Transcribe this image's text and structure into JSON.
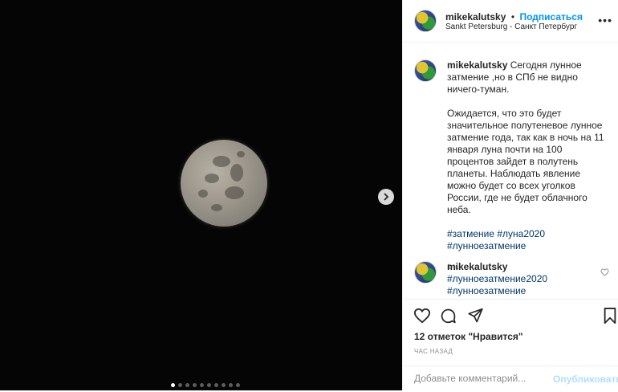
{
  "post": {
    "author": "mikekalutsky",
    "separator": "•",
    "follow_label": "Подписаться",
    "location": "Sankt Petersburg - Санкт Петербург",
    "more_icon": "more-horizontal-icon"
  },
  "caption": {
    "username": "mikekalutsky",
    "paragraph1": "Сегодня лунное затмение ,но в СПб не видно ничего-туман.",
    "paragraph2": "Ожидается, что это будет значительное полутеневое лунное затмение года, так как в ночь на 11 января луна почти на 100 процентов зайдет в полутень планеты. Наблюдать явление можно будет со всех уголков России, где не будет облачного неба.",
    "hashtags": [
      "#затмение",
      "#луна2020",
      "#лунноезатмение"
    ],
    "time": "1 ч."
  },
  "comment": {
    "username": "mikekalutsky",
    "hashtags": [
      "#лунноезатмение2020",
      "#лунноезатмение"
    ]
  },
  "actions": {
    "likes": "12 отметок \"Нравится\"",
    "time_ago": "ЧАС НАЗАД",
    "comment_placeholder": "Добавьте комментарий...",
    "publish_label": "Опубликовать"
  },
  "carousel": {
    "slide_count": 10,
    "active_index": 0
  },
  "colors": {
    "accent": "#0095f6",
    "publish_disabled": "#b2dffc",
    "hashtag": "#00376b"
  }
}
